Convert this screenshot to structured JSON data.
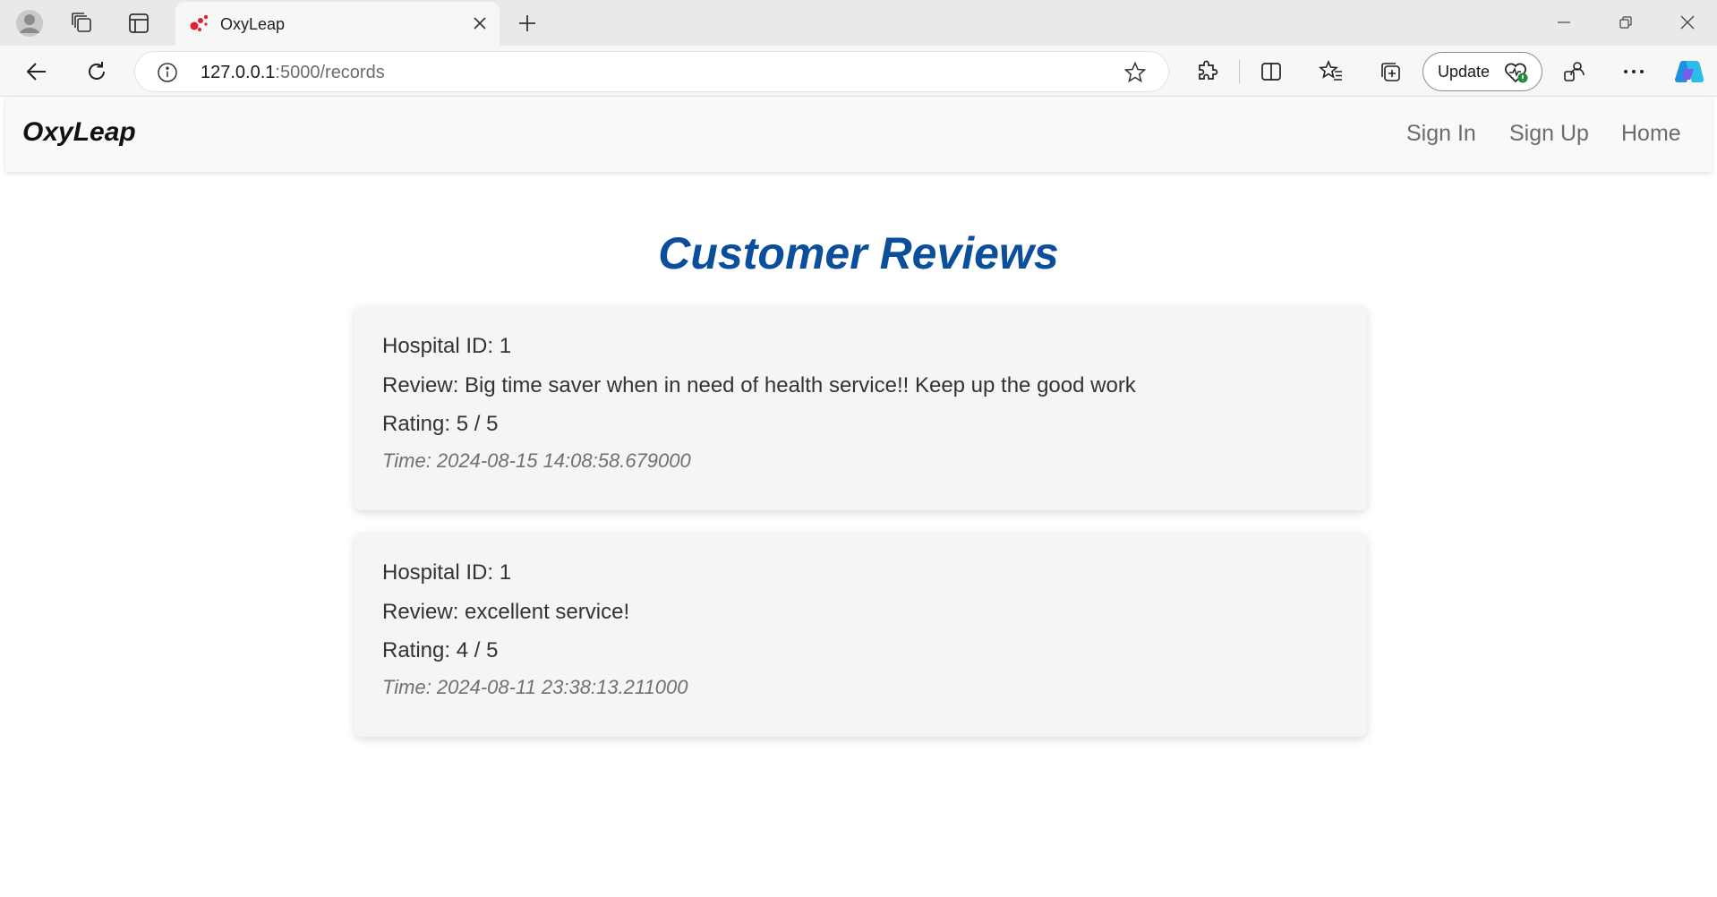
{
  "browser": {
    "tab_title": "OxyLeap",
    "url_host": "127.0.0.1",
    "url_path": ":5000/records",
    "update_label": "Update"
  },
  "icons": {
    "profile": "profile-avatar-icon",
    "workspaces": "workspaces-icon",
    "tab_actions": "tab-actions-icon",
    "favicon": "oxyleap-favicon",
    "close_tab": "close-icon",
    "new_tab": "plus-icon",
    "minimize": "minimize-icon",
    "restore": "restore-icon",
    "close_window": "close-window-icon",
    "back": "back-arrow-icon",
    "refresh": "refresh-icon",
    "site_info": "info-icon",
    "favorite": "star-icon",
    "extensions": "puzzle-icon",
    "split_screen": "split-screen-icon",
    "favorites": "favorites-icon",
    "collections": "collections-icon",
    "health": "heart-badge-icon",
    "profile_switch": "profile-switch-icon",
    "more": "more-icon",
    "copilot": "copilot-icon"
  },
  "colors": {
    "title_blue": "#0b4f9c",
    "navbar_bg": "#f8f9fa",
    "card_bg": "#f5f5f7",
    "favicon_red": "#e0202f"
  },
  "navbar": {
    "brand": "OxyLeap",
    "links": [
      "Sign In",
      "Sign Up",
      "Home"
    ]
  },
  "main": {
    "title": "Customer Reviews",
    "reviews": [
      {
        "hospital": "Hospital ID: 1",
        "review": "Review: Big time saver when in need of health service!! Keep up the good work",
        "rating": "Rating: 5 / 5",
        "time": "Time: 2024-08-15 14:08:58.679000"
      },
      {
        "hospital": "Hospital ID: 1",
        "review": "Review: excellent service!",
        "rating": "Rating: 4 / 5",
        "time": "Time: 2024-08-11 23:38:13.211000"
      }
    ]
  }
}
